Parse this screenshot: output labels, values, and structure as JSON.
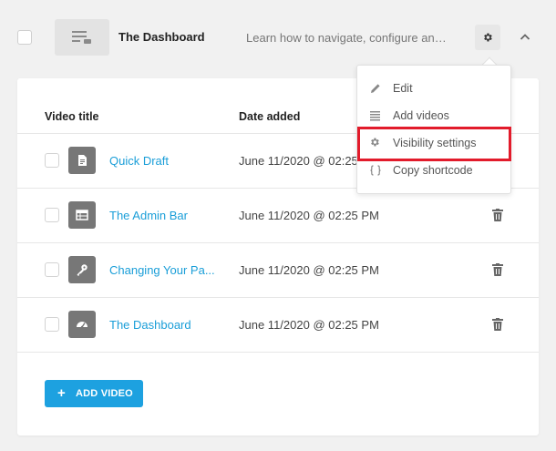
{
  "header": {
    "title": "The Dashboard",
    "description": "Learn how to navigate, configure and c...",
    "settings_icon": "gear-icon",
    "collapse_icon": "chevron-up-icon"
  },
  "table": {
    "columns": [
      "Video title",
      "Date added"
    ],
    "rows": [
      {
        "title": "Quick Draft",
        "date": "June 11/2020 @ 02:25",
        "icon": "document-icon"
      },
      {
        "title": "The Admin Bar",
        "date": "June 11/2020 @ 02:25 PM",
        "icon": "table-icon"
      },
      {
        "title": "Changing Your Pa...",
        "date": "June 11/2020 @ 02:25 PM",
        "icon": "key-icon"
      },
      {
        "title": "The Dashboard",
        "date": "June 11/2020 @ 02:25 PM",
        "icon": "dashboard-icon"
      }
    ]
  },
  "add_button": {
    "label": "ADD VIDEO",
    "plus": "+"
  },
  "menu": {
    "items": [
      {
        "label": "Edit",
        "icon": "pencil-icon"
      },
      {
        "label": "Add videos",
        "icon": "list-icon"
      },
      {
        "label": "Visibility settings",
        "icon": "gear-icon"
      },
      {
        "label": "Copy shortcode",
        "icon": "code-braces-icon"
      }
    ],
    "highlighted": "Visibility settings"
  },
  "colors": {
    "accent": "#1da1e0",
    "link": "#1a9ed8",
    "highlight": "#e21b2b",
    "icon_bg": "#777777"
  }
}
